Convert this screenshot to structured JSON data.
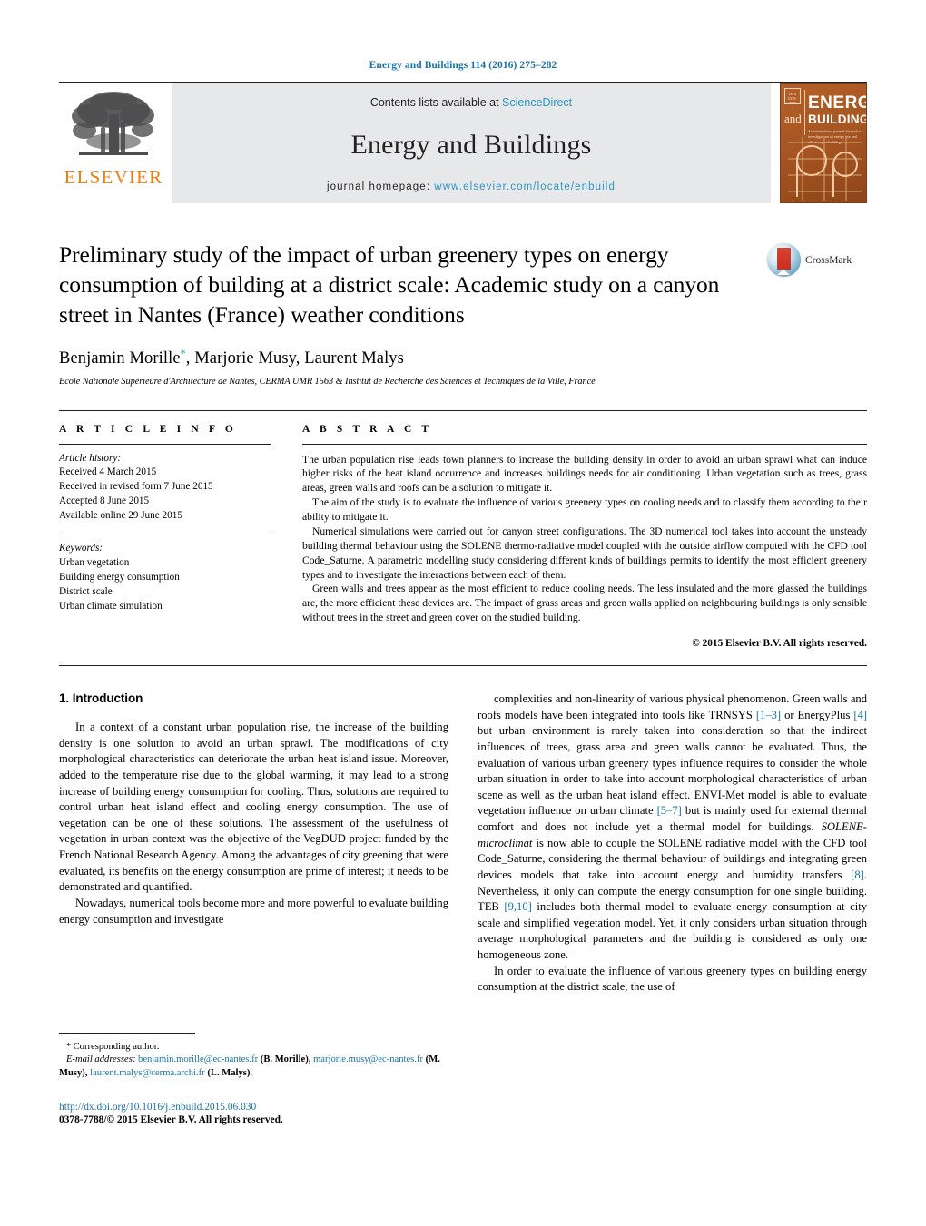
{
  "running_head": "Energy and Buildings 114 (2016) 275–282",
  "masthead": {
    "publisher_name": "ELSEVIER",
    "contents_prefix": "Contents lists available at ",
    "contents_link": "ScienceDirect",
    "journal_title": "Energy and Buildings",
    "homepage_prefix": "journal homepage: ",
    "homepage_url": "www.elsevier.com/locate/enbuild",
    "cover": {
      "badge": "ISSN 0378-7788",
      "energy": "ENERGY",
      "and": "and",
      "buildings": "BUILDINGS",
      "subtitle": "An international journal devoted to investigations of energy use and efficiency in buildings"
    }
  },
  "article": {
    "title": "Preliminary study of the impact of urban greenery types on energy consumption of building at a district scale: Academic study on a canyon street in Nantes (France) weather conditions",
    "authors": "Benjamin Morille, Marjorie Musy, Laurent Malys",
    "author_star": "*",
    "affiliation": "Ecole Nationale Supérieure d'Architecture de Nantes, CERMA UMR 1563 & Institut de Recherche des Sciences et Techniques de la Ville, France",
    "crossmark_label": "CrossMark"
  },
  "info": {
    "heading": "A R T I C L E   I N F O",
    "history_label": "Article history:",
    "history": [
      "Received 4 March 2015",
      "Received in revised form 7 June 2015",
      "Accepted 8 June 2015",
      "Available online 29 June 2015"
    ],
    "keywords_label": "Keywords:",
    "keywords": [
      "Urban vegetation",
      "Building energy consumption",
      "District scale",
      "Urban climate simulation"
    ]
  },
  "abstract": {
    "heading": "A B S T R A C T",
    "paragraphs": [
      "The urban population rise leads town planners to increase the building density in order to avoid an urban sprawl what can induce higher risks of the heat island occurrence and increases buildings needs for air conditioning. Urban vegetation such as trees, grass areas, green walls and roofs can be a solution to mitigate it.",
      "The aim of the study is to evaluate the influence of various greenery types on cooling needs and to classify them according to their ability to mitigate it.",
      "Numerical simulations were carried out for canyon street configurations. The 3D numerical tool takes into account the unsteady building thermal behaviour using the SOLENE thermo-radiative model coupled with the outside airflow computed with the CFD tool Code_Saturne. A parametric modelling study considering different kinds of buildings permits to identify the most efficient greenery types and to investigate the interactions between each of them.",
      "Green walls and trees appear as the most efficient to reduce cooling needs. The less insulated and the more glassed the buildings are, the more efficient these devices are. The impact of grass areas and green walls applied on neighbouring buildings is only sensible without trees in the street and green cover on the studied building."
    ],
    "copyright": "© 2015 Elsevier B.V. All rights reserved."
  },
  "introduction": {
    "number_title": "1.  Introduction",
    "left_paragraphs": [
      "In a context of a constant urban population rise, the increase of the building density is one solution to avoid an urban sprawl. The modifications of city morphological characteristics can deteriorate the urban heat island issue. Moreover, added to the temperature rise due to the global warming, it may lead to a strong increase of building energy consumption for cooling. Thus, solutions are required to control urban heat island effect and cooling energy consumption. The use of vegetation can be one of these solutions. The assessment of the usefulness of vegetation in urban context was the objective of the VegDUD project funded by the French National Research Agency. Among the advantages of city greening that were evaluated, its benefits on the energy consumption are prime of interest; it needs to be demonstrated and quantified.",
      "Nowadays, numerical tools become more and more powerful to evaluate building energy consumption and investigate"
    ],
    "right_paragraphs": [
      "complexities and non-linearity of various physical phenomenon. Green walls and roofs models have been integrated into tools like TRNSYS [1–3] or EnergyPlus [4] but urban environment is rarely taken into consideration so that the indirect influences of trees, grass area and green walls cannot be evaluated. Thus, the evaluation of various urban greenery types influence requires to consider the whole urban situation in order to take into account morphological characteristics of urban scene as well as the urban heat island effect. ENVI-Met model is able to evaluate vegetation influence on urban climate [5–7] but is mainly used for external thermal comfort and does not include yet a thermal model for buildings. SOLENE-microclimat is now able to couple the SOLENE radiative model with the CFD tool Code_Saturne, considering the thermal behaviour of buildings and integrating green devices models that take into account energy and humidity transfers [8]. Nevertheless, it only can compute the energy consumption for one single building. TEB [9,10] includes both thermal model to evaluate energy consumption at city scale and simplified vegetation model. Yet, it only considers urban situation through average morphological parameters and the building is considered as only one homogeneous zone.",
      "In order to evaluate the influence of various greenery types on building energy consumption at the district scale, the use of"
    ],
    "references_inline": [
      "[1–3]",
      "[4]",
      "[5–7]",
      "[8]",
      "[9,10]"
    ]
  },
  "footnote": {
    "corresponding_star": "*",
    "corresponding_label": "Corresponding author.",
    "email_label": "E-mail addresses:",
    "emails": [
      {
        "address": "benjamin.morille@ec-nantes.fr",
        "who": "(B. Morille),"
      },
      {
        "address": "marjorie.musy@ec-nantes.fr",
        "who": "(M. Musy),"
      },
      {
        "address": "laurent.malys@cerma.archi.fr",
        "who": "(L. Malys)."
      }
    ],
    "doi": "http://dx.doi.org/10.1016/j.enbuild.2015.06.030",
    "issn_line": "0378-7788/© 2015 Elsevier B.V. All rights reserved."
  },
  "colors": {
    "link_blue": "#1673a8",
    "science_direct_blue": "#2a96c8",
    "elsevier_orange": "#f07f13",
    "band_gray": "#e7e8e9",
    "cover_orange": "#a85622"
  }
}
